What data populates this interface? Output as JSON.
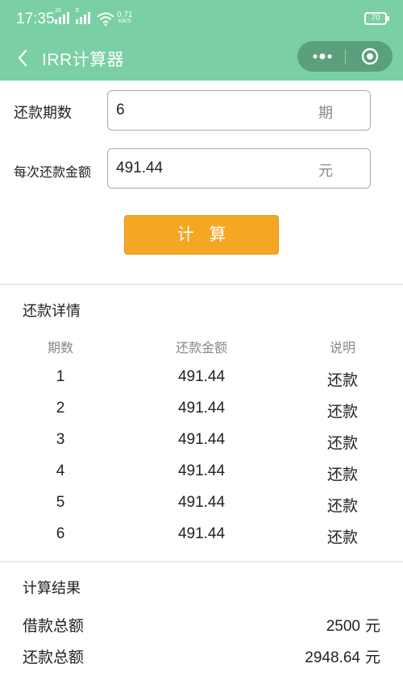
{
  "status_bar": {
    "time": "17:35",
    "signal1_tag": "26",
    "signal2_tag": "E",
    "net_speed": "0.71",
    "net_unit": "KB/S",
    "battery": "70"
  },
  "nav": {
    "title": "IRR计算器"
  },
  "form": {
    "periods_label": "还款期数",
    "periods_value": "6",
    "periods_unit": "期",
    "amount_label": "每次还款金额",
    "amount_value": "491.44",
    "amount_unit": "元"
  },
  "calculate_label": "计 算",
  "details": {
    "title": "还款详情",
    "columns": [
      "期数",
      "还款金额",
      "说明"
    ],
    "rows": [
      [
        "1",
        "491.44",
        "还款"
      ],
      [
        "2",
        "491.44",
        "还款"
      ],
      [
        "3",
        "491.44",
        "还款"
      ],
      [
        "4",
        "491.44",
        "还款"
      ],
      [
        "5",
        "491.44",
        "还款"
      ],
      [
        "6",
        "491.44",
        "还款"
      ]
    ]
  },
  "result": {
    "title": "计算结果",
    "loan_label": "借款总额",
    "loan_value": "2500",
    "repay_label": "还款总额",
    "repay_value": "2948.64",
    "unit": "元"
  },
  "colors": {
    "header": "#7acfa4",
    "button": "#f5a623"
  }
}
